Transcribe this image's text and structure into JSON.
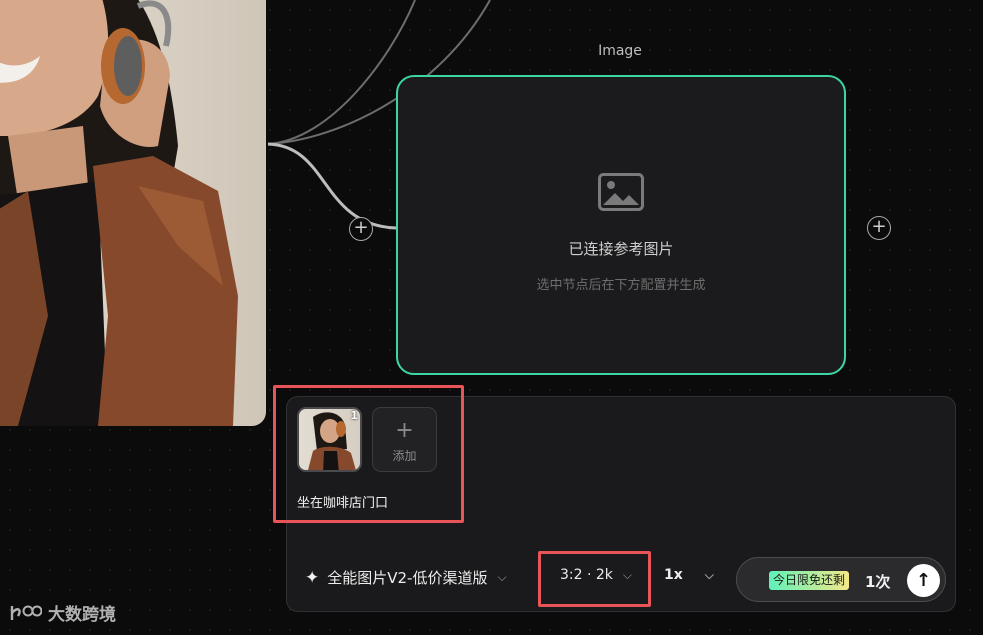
{
  "canvas": {
    "node_title": "Image",
    "placeholder_title": "已连接参考图片",
    "placeholder_subtitle": "选中节点后在下方配置并生成",
    "add_port_label": "+"
  },
  "composer": {
    "reference_index": "1",
    "add_tile": {
      "icon": "+",
      "label": "添加"
    },
    "prompt": "坐在咖啡店门口",
    "model": {
      "icon": "✦",
      "label": "全能图片V2-低价渠道版",
      "chevron": "⌵"
    },
    "ratio": {
      "label": "3:2 · 2k",
      "chevron": "⌵"
    },
    "count": {
      "label": "1x",
      "chevron": "⌵"
    },
    "promo_badge": "今日限免还剩",
    "remaining": "1次",
    "send_icon": "↑"
  },
  "watermark": {
    "text": "大数跨境"
  },
  "colors": {
    "node_border": "#3dd6a3",
    "highlight": "#e95459",
    "badge_from": "#5ff0b8",
    "badge_to": "#f4ea88"
  },
  "icons": [
    "image-placeholder-icon",
    "plus-icon",
    "sparkle-icon",
    "chevron-down-icon",
    "arrow-up-icon"
  ]
}
